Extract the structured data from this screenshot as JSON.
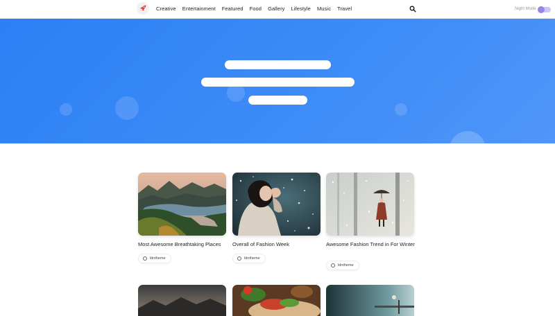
{
  "nav": {
    "logo_icon": "rocket-icon",
    "menu": [
      "Creative",
      "Entertainment",
      "Featured",
      "Food",
      "Gallery",
      "Lifestyle",
      "Music",
      "Travel"
    ],
    "search_icon": "search-icon",
    "night_mode_label": "Night Mode",
    "night_mode_on": false
  },
  "hero": {
    "accent": "#2c7ff5"
  },
  "posts": [
    {
      "title": "Most Awesome Breathtaking Places",
      "author": "ldntheme",
      "image": "mountain-lake-landscape"
    },
    {
      "title": "Overall of Fashion Week",
      "author": "ldntheme",
      "image": "woman-in-snow"
    },
    {
      "title": "Awesome Fashion Trend in For Winter",
      "author": "ldntheme",
      "image": "woman-umbrella-snowy-forest"
    },
    {
      "title": "",
      "author": "",
      "image": "dark-mountains"
    },
    {
      "title": "",
      "author": "",
      "image": "food-wrap"
    },
    {
      "title": "",
      "author": "",
      "image": "misty-pier"
    }
  ]
}
